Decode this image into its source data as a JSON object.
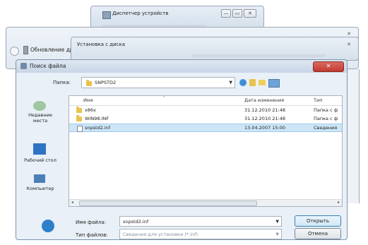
{
  "device_manager": {
    "title": "Диспетчер устройств",
    "min": "—",
    "max": "▭",
    "close": "✕"
  },
  "update_window": {
    "title": "Обновление драйвер",
    "close": "✕"
  },
  "install_dialog": {
    "title": "Установка с диска",
    "close": "✕"
  },
  "find_file": {
    "title": "Поиск файла",
    "folder_label": "Папка:",
    "folder_value": "SNPSTD2",
    "places": [
      {
        "label": "Недавние места",
        "icon": "recent-places-icon"
      },
      {
        "label": "Рабочий стол",
        "icon": "desktop-icon"
      },
      {
        "label": "Компьютер",
        "icon": "computer-icon"
      },
      {
        "label": "",
        "icon": "network-icon"
      }
    ],
    "columns": [
      "Имя",
      "Дата изменения",
      "Тип"
    ],
    "files": [
      {
        "name": "x86x",
        "date": "31.12.2010 21:48",
        "type": "Папка с ф"
      },
      {
        "name": "WIN98.INF",
        "date": "31.12.2010 21:48",
        "type": "Папка с ф"
      },
      {
        "name": "snpstd2.inf",
        "date": "13.04.2007 15:00",
        "type": "Сведения"
      }
    ],
    "filename_label": "Имя файла:",
    "filename_value": "snpstd2.inf",
    "filetype_label": "Тип файлов:",
    "filetype_value": "Сведения для установки (*.inf)",
    "open_button": "Открыть",
    "cancel_button": "Отмена"
  },
  "colors": {
    "selection": "#cde6f7",
    "close_red": "#c9463d",
    "title_blue": "#dfe8f2"
  }
}
